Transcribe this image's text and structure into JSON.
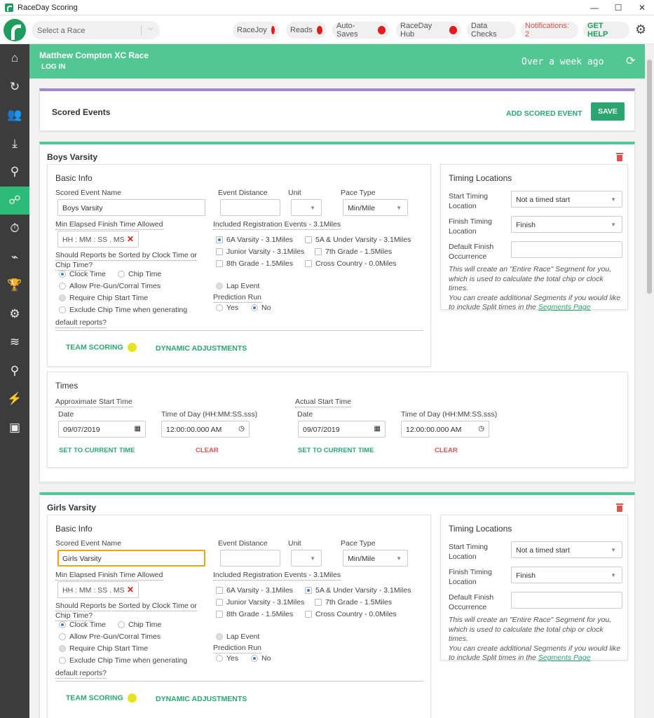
{
  "window": {
    "title": "RaceDay Scoring",
    "min": "—",
    "max": "☐",
    "close": "✕"
  },
  "topbar": {
    "race_placeholder": "Select a Race",
    "racejoy": "RaceJoy",
    "reads": "Reads",
    "autosaves": "Auto-Saves",
    "hub": "RaceDay Hub",
    "datachecks": "Data Checks",
    "notifications": "Notifications: 2",
    "help": "GET HELP",
    "status_color": "#e21b1b"
  },
  "header": {
    "race_title": "Matthew Compton XC Race",
    "login": "LOG IN",
    "updated": "Over a week ago"
  },
  "scored": {
    "title": "Scored Events",
    "add": "ADD SCORED EVENT",
    "save": "SAVE"
  },
  "labels": {
    "basic_info": "Basic Info",
    "name": "Scored Event Name",
    "distance": "Event Distance",
    "unit": "Unit",
    "pace_type": "Pace Type",
    "min_elapsed": "Min Elapsed Finish Time Allowed",
    "time_placeholder": "HH : MM : SS . MS",
    "sort_q1": "Should Reports be Sorted by Clock Time or",
    "sort_q2": "Chip Time?",
    "clock": "Clock Time",
    "chip": "Chip Time",
    "pregun": "Allow Pre-Gun/Corral Times",
    "require_chip": "Require Chip Start Time",
    "exclude1": "Exclude Chip Time when generating",
    "exclude2": "default reports?",
    "lap": "Lap Event",
    "prediction": "Prediction Run",
    "yes": "Yes",
    "no": "No",
    "team_scoring": "TEAM SCORING",
    "dynamic": "DYNAMIC ADJUSTMENTS",
    "timing_locations": "Timing Locations",
    "start_loc1": "Start Timing",
    "start_loc2": "Location",
    "finish_loc1": "Finish Timing",
    "finish_loc2": "Location",
    "default_finish1": "Default Finish",
    "default_finish2": "Occurrence",
    "start_value": "Not a timed start",
    "finish_value": "Finish",
    "note1": "This will create an \"Entire Race\" Segment for you,",
    "note2": "which is used to calculate the total chip or clock times.",
    "note3": "You can create additional Segments if you would like",
    "note4": "to include Split times in the ",
    "note_link": "Segments Page",
    "times": "Times",
    "approx_start": "Approximate Start Time",
    "actual_start": "Actual Start Time",
    "date": "Date",
    "tod": "Time of Day (HH:MM:SS.sss)",
    "set_current": "SET TO CURRENT TIME",
    "clear": "CLEAR"
  },
  "events": [
    {
      "title": "Boys Varsity",
      "name_value": "Boys Varsity",
      "pace_value": "Min/Mile",
      "included": "Included Registration Events - 3.1Miles",
      "reg": [
        "6A Varsity - 3.1Miles",
        "5A & Under Varsity - 3.1Miles",
        "Junior Varsity - 3.1Miles",
        "7th Grade - 1.5Miles",
        "8th Grade - 1.5Miles",
        "Cross Country - 0.0Miles"
      ],
      "approx_date": "09/07/2019",
      "approx_time": "12:00:00.000 AM",
      "actual_date": "09/07/2019",
      "actual_time": "12:00:00.000 AM"
    },
    {
      "title": "Girls Varsity",
      "name_value": "Girls Varsity",
      "pace_value": "Min/Mile",
      "included": "Included Registration Events - 3.1Miles",
      "reg": [
        "6A Varsity - 3.1Miles",
        "5A & Under Varsity - 3.1Miles",
        "Junior Varsity - 3.1Miles",
        "7th Grade - 1.5Miles",
        "8th Grade - 1.5Miles",
        "Cross Country - 0.0Miles"
      ]
    }
  ]
}
